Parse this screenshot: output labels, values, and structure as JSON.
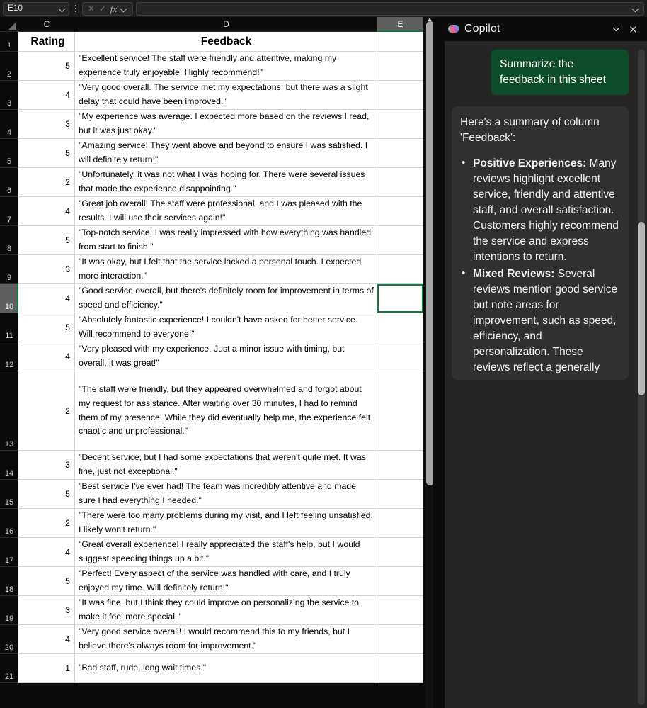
{
  "formula_bar": {
    "name_box_value": "E10",
    "formula_value": "",
    "cancel_icon": "close-icon",
    "confirm_icon": "check-icon",
    "function_icon": "fx-icon"
  },
  "spreadsheet": {
    "columns": [
      "C",
      "D",
      "E"
    ],
    "selected_column": "E",
    "selected_row": "10",
    "selected_cell": "E10",
    "header_row_number": "1",
    "headers": {
      "rating": "Rating",
      "feedback": "Feedback"
    },
    "rows": [
      {
        "n": "2",
        "rating": "5",
        "feedback": "\"Excellent service! The staff were friendly and attentive, making my experience truly enjoyable. Highly recommend!\""
      },
      {
        "n": "3",
        "rating": "4",
        "feedback": "\"Very good overall. The service met my expectations, but there was a slight delay that could have been improved.\""
      },
      {
        "n": "4",
        "rating": "3",
        "feedback": "\"My experience was average. I expected more based on the reviews I read, but it was just okay.\""
      },
      {
        "n": "5",
        "rating": "5",
        "feedback": "\"Amazing service! They went above and beyond to ensure I was satisfied. I will definitely return!\""
      },
      {
        "n": "6",
        "rating": "2",
        "feedback": "\"Unfortunately, it was not what I was hoping for. There were several issues that made the experience disappointing.\""
      },
      {
        "n": "7",
        "rating": "4",
        "feedback": "\"Great job overall! The staff were professional, and I was pleased with the results. I will use their services again!\""
      },
      {
        "n": "8",
        "rating": "5",
        "feedback": "\"Top-notch service! I was really impressed with how everything was handled from start to finish.\""
      },
      {
        "n": "9",
        "rating": "3",
        "feedback": "\"It was okay, but I felt that the service lacked a personal touch. I expected more interaction.\""
      },
      {
        "n": "10",
        "rating": "4",
        "feedback": "\"Good service overall, but there's definitely room for improvement in terms of speed and efficiency.\""
      },
      {
        "n": "11",
        "rating": "5",
        "feedback": "\"Absolutely fantastic experience! I couldn't have asked for better service. Will recommend to everyone!\""
      },
      {
        "n": "12",
        "rating": "4",
        "feedback": "\"Very pleased with my experience. Just a minor issue with timing, but overall, it was great!\""
      },
      {
        "n": "13",
        "rating": "2",
        "feedback": "\"The staff were friendly, but they appeared overwhelmed and forgot about my request for assistance. After waiting over 30 minutes, I had to remind them of my presence. While they did eventually help me, the experience felt chaotic and unprofessional.\""
      },
      {
        "n": "14",
        "rating": "3",
        "feedback": "\"Decent service, but I had some expectations that weren't quite met. It was fine, just not exceptional.\""
      },
      {
        "n": "15",
        "rating": "5",
        "feedback": "\"Best service I've ever had! The team was incredibly attentive and made sure I had everything I needed.\""
      },
      {
        "n": "16",
        "rating": "2",
        "feedback": "\"There were too many problems during my visit, and I left feeling unsatisfied. I likely won't return.\""
      },
      {
        "n": "17",
        "rating": "4",
        "feedback": "\"Great overall experience! I really appreciated the staff's help, but I would suggest speeding things up a bit.\""
      },
      {
        "n": "18",
        "rating": "5",
        "feedback": "\"Perfect! Every aspect of the service was handled with care, and I truly enjoyed my time. Will definitely return!\""
      },
      {
        "n": "19",
        "rating": "3",
        "feedback": "\"It was fine, but I think they could improve on personalizing the service to make it feel more special.\""
      },
      {
        "n": "20",
        "rating": "4",
        "feedback": "\"Very good service overall! I would recommend this to my friends, but I believe there's always room for improvement.\""
      },
      {
        "n": "21",
        "rating": "1",
        "feedback": "\"Bad staff, rude, long wait times.\""
      }
    ]
  },
  "copilot": {
    "title": "Copilot",
    "logo_icon": "copilot-logo-icon",
    "collapse_icon": "chevron-down-icon",
    "close_icon": "close-icon",
    "user_message": "Summarize the feedback in this sheet",
    "response_intro": "Here's a summary of column 'Feedback':",
    "response_bullets": [
      {
        "label": "Positive Experiences:",
        "text": " Many reviews highlight excellent service, friendly and attentive staff, and overall satisfaction. Customers highly recommend the service and express intentions to return."
      },
      {
        "label": "Mixed Reviews:",
        "text": " Several reviews mention good service but note areas for improvement, such as speed, efficiency, and personalization. These reviews reflect a generally"
      }
    ],
    "accent_green": "#107c41",
    "user_bubble_green": "#0d4d2b"
  }
}
